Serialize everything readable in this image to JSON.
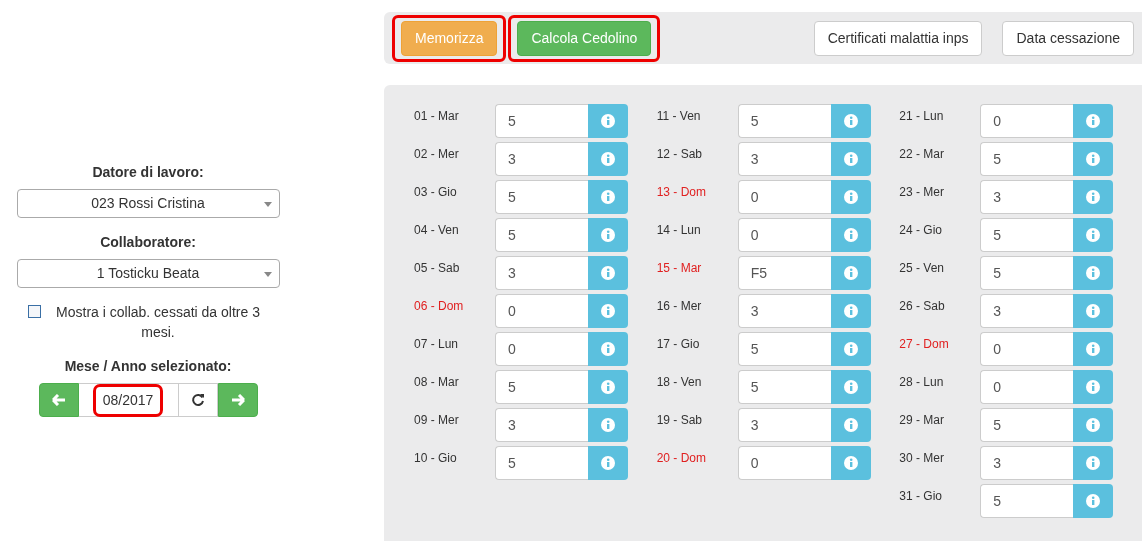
{
  "sidebar": {
    "employer_label": "Datore di lavoro:",
    "employer": "023 Rossi Cristina",
    "collaborator_label": "Collaboratore:",
    "collaborator": "1 Tosticku Beata",
    "show_ceased": {
      "label": "Mostra i collab. cessati da oltre 3 mesi.",
      "checked": false
    },
    "period_label": "Mese / Anno selezionato:",
    "period": {
      "value": "08/2017",
      "highlighted": true
    }
  },
  "toolbar": {
    "buttons": [
      {
        "label": "Memorizza",
        "kind": "warning",
        "highlighted": true
      },
      {
        "label": "Calcola Cedolino",
        "kind": "success",
        "highlighted": true
      },
      {
        "label": "Certificati malattia inps",
        "kind": "plain",
        "highlighted": false
      },
      {
        "label": "Data cessazione",
        "kind": "plain",
        "highlighted": false
      }
    ]
  },
  "day_columns": [
    [
      {
        "label": "01 - Mar",
        "value": "5",
        "holiday": false
      },
      {
        "label": "02 - Mer",
        "value": "3",
        "holiday": false
      },
      {
        "label": "03 - Gio",
        "value": "5",
        "holiday": false
      },
      {
        "label": "04 - Ven",
        "value": "5",
        "holiday": false
      },
      {
        "label": "05 - Sab",
        "value": "3",
        "holiday": false
      },
      {
        "label": "06 - Dom",
        "value": "0",
        "holiday": true
      },
      {
        "label": "07 - Lun",
        "value": "0",
        "holiday": false
      },
      {
        "label": "08 - Mar",
        "value": "5",
        "holiday": false
      },
      {
        "label": "09 - Mer",
        "value": "3",
        "holiday": false
      },
      {
        "label": "10 - Gio",
        "value": "5",
        "holiday": false
      }
    ],
    [
      {
        "label": "11 - Ven",
        "value": "5",
        "holiday": false
      },
      {
        "label": "12 - Sab",
        "value": "3",
        "holiday": false
      },
      {
        "label": "13 - Dom",
        "value": "0",
        "holiday": true
      },
      {
        "label": "14 - Lun",
        "value": "0",
        "holiday": false
      },
      {
        "label": "15 - Mar",
        "value": "F5",
        "holiday": true
      },
      {
        "label": "16 - Mer",
        "value": "3",
        "holiday": false
      },
      {
        "label": "17 - Gio",
        "value": "5",
        "holiday": false
      },
      {
        "label": "18 - Ven",
        "value": "5",
        "holiday": false
      },
      {
        "label": "19 - Sab",
        "value": "3",
        "holiday": false
      },
      {
        "label": "20 - Dom",
        "value": "0",
        "holiday": true
      }
    ],
    [
      {
        "label": "21 - Lun",
        "value": "0",
        "holiday": false
      },
      {
        "label": "22 - Mar",
        "value": "5",
        "holiday": false
      },
      {
        "label": "23 - Mer",
        "value": "3",
        "holiday": false
      },
      {
        "label": "24 - Gio",
        "value": "5",
        "holiday": false
      },
      {
        "label": "25 - Ven",
        "value": "5",
        "holiday": false
      },
      {
        "label": "26 - Sab",
        "value": "3",
        "holiday": false
      },
      {
        "label": "27 - Dom",
        "value": "0",
        "holiday": true
      },
      {
        "label": "28 - Lun",
        "value": "0",
        "holiday": false
      },
      {
        "label": "29 - Mar",
        "value": "5",
        "holiday": false
      },
      {
        "label": "30 - Mer",
        "value": "3",
        "holiday": false
      },
      {
        "label": "31 - Gio",
        "value": "5",
        "holiday": false
      }
    ]
  ]
}
